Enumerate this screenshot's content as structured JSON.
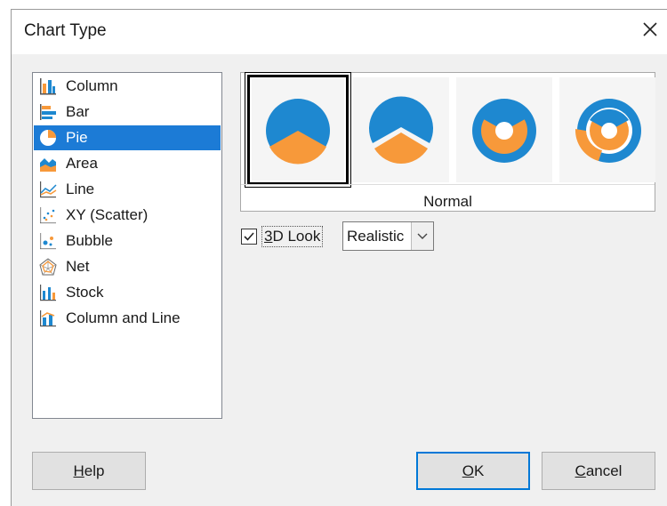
{
  "dialog": {
    "title": "Chart Type"
  },
  "chart_types": [
    {
      "label": "Column",
      "icon": "column-chart-icon",
      "selected": false
    },
    {
      "label": "Bar",
      "icon": "bar-chart-icon",
      "selected": false
    },
    {
      "label": "Pie",
      "icon": "pie-chart-icon",
      "selected": true
    },
    {
      "label": "Area",
      "icon": "area-chart-icon",
      "selected": false
    },
    {
      "label": "Line",
      "icon": "line-chart-icon",
      "selected": false
    },
    {
      "label": "XY (Scatter)",
      "icon": "scatter-chart-icon",
      "selected": false
    },
    {
      "label": "Bubble",
      "icon": "bubble-chart-icon",
      "selected": false
    },
    {
      "label": "Net",
      "icon": "net-chart-icon",
      "selected": false
    },
    {
      "label": "Stock",
      "icon": "stock-chart-icon",
      "selected": false
    },
    {
      "label": "Column and Line",
      "icon": "column-and-line-chart-icon",
      "selected": false
    }
  ],
  "variants": {
    "selected_name": "Normal",
    "items": [
      {
        "icon": "pie-normal-icon",
        "selected": true
      },
      {
        "icon": "pie-exploded-icon",
        "selected": false
      },
      {
        "icon": "donut-icon",
        "selected": false
      },
      {
        "icon": "donut-exploded-icon",
        "selected": false
      }
    ]
  },
  "options": {
    "look3d": {
      "label": "3D Look",
      "mnemonic": "3",
      "checked": true
    },
    "scheme": {
      "value": "Realistic"
    }
  },
  "buttons": {
    "help": {
      "mnemonic": "H",
      "rest": "elp"
    },
    "ok": {
      "mnemonic": "O",
      "rest": "K"
    },
    "cancel": {
      "mnemonic": "C",
      "rest": "ancel"
    }
  },
  "colors": {
    "selection": "#1c7bd6",
    "pie_blue": "#1e88d0",
    "pie_orange": "#f7993a",
    "default_button_border": "#0078d7"
  }
}
